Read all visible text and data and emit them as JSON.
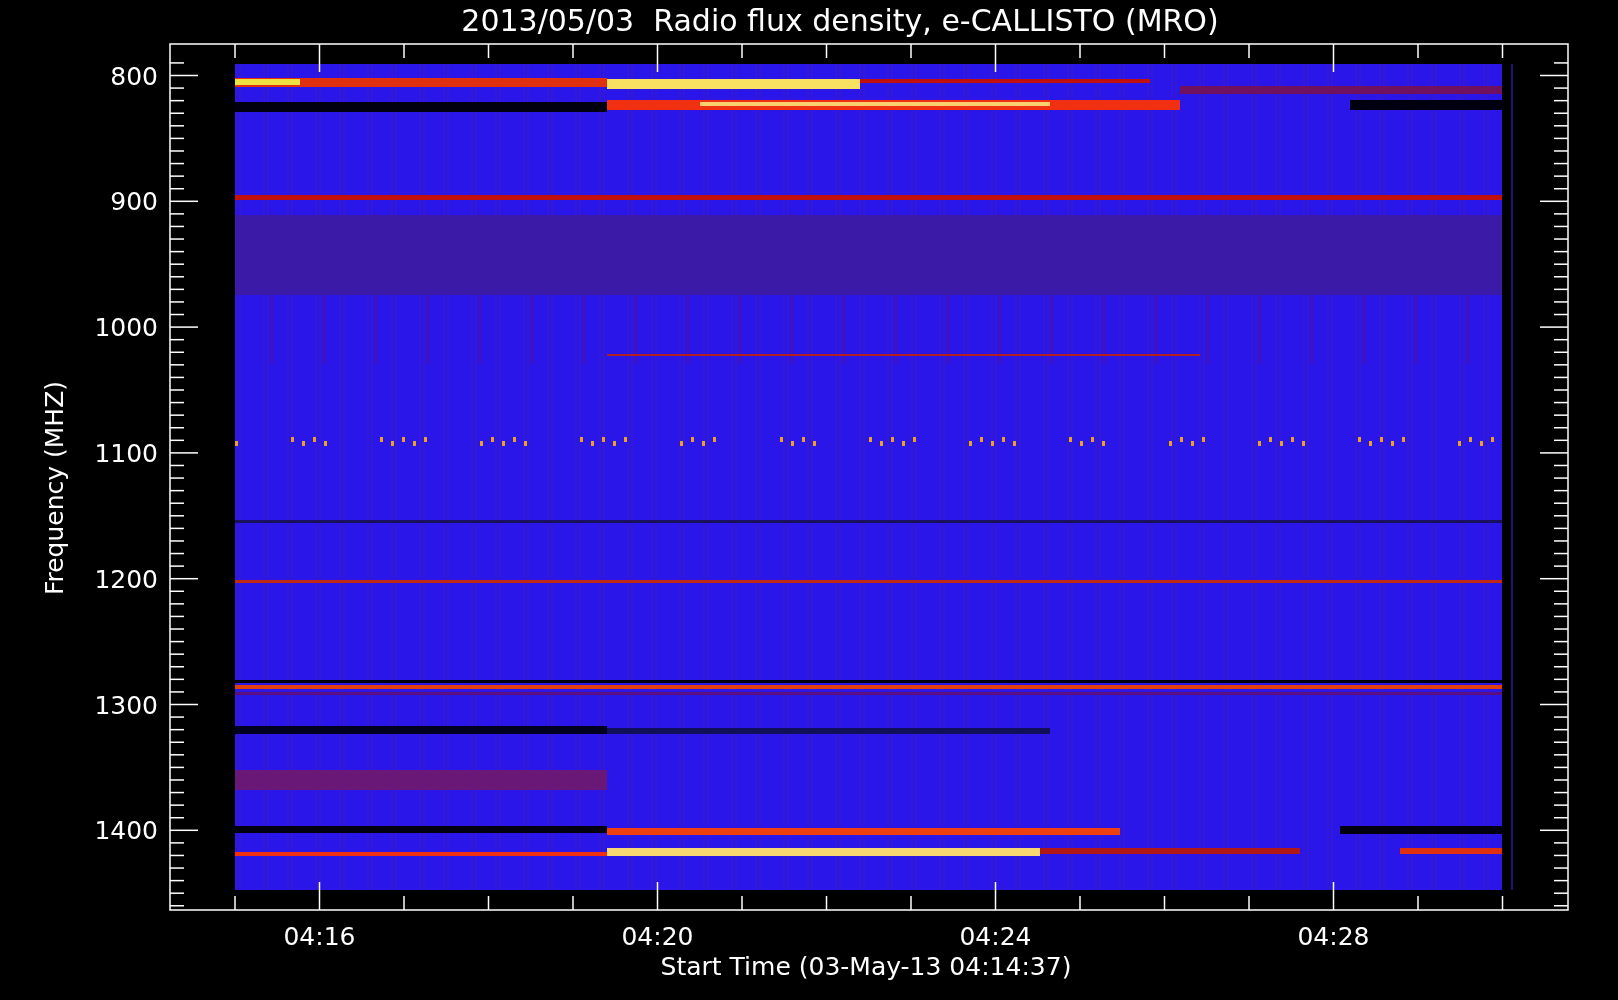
{
  "title": "2013/05/03  Radio flux density, e-CALLISTO (MRO)",
  "y_axis": {
    "label": "Frequency (MHZ)",
    "ticks": [
      "800",
      "900",
      "1000",
      "1100",
      "1200",
      "1300",
      "1400"
    ]
  },
  "x_axis": {
    "label": "Start Time (03-May-13 04:14:37)",
    "ticks": [
      "04:16",
      "04:20",
      "04:24",
      "04:28"
    ]
  }
}
